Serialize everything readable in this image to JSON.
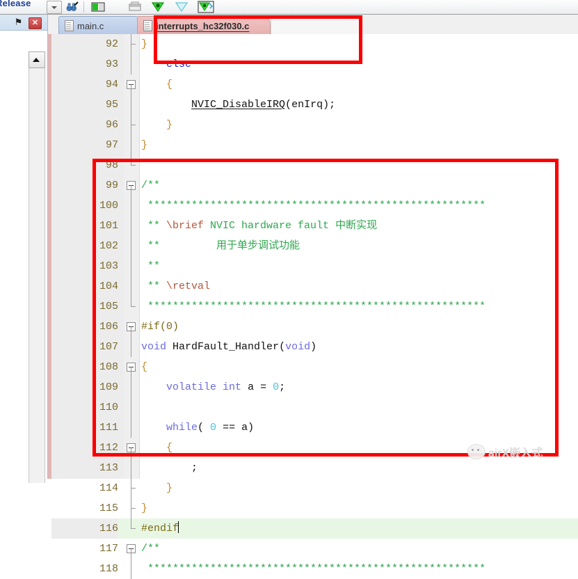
{
  "toolbar": {
    "target_label": "Release",
    "buttons": [
      {
        "name": "target-options-dropdown",
        "icon": "chevron-down-icon"
      },
      {
        "name": "binoculars-button",
        "icon": "binoculars-icon"
      },
      {
        "name": "manage-project-items-button",
        "icon": "project-items-icon"
      },
      {
        "name": "window-button",
        "icon": "window-icon"
      },
      {
        "name": "configure-target-button",
        "icon": "green-diamond-icon"
      },
      {
        "name": "filter-button",
        "icon": "funnel-icon"
      },
      {
        "name": "manage-components-button",
        "icon": "components-icon"
      }
    ]
  },
  "dock": {
    "pin_icon": "pin-icon",
    "pin_glyph": "⚑",
    "close_label": "✕"
  },
  "tabs": {
    "items": [
      {
        "label": "main.c",
        "active": false,
        "name": "tab-main-c"
      },
      {
        "label": "interrupts_hc32f030.c",
        "active": true,
        "name": "tab-interrupts-hc32f030-c"
      }
    ]
  },
  "annotations": {
    "tab_highlight_color": "#fb0000",
    "code_highlight_color": "#fb0000"
  },
  "watermark": {
    "text": "airX嵌入式",
    "logo": "wechat-logo-icon"
  },
  "editor": {
    "current_line": 116,
    "lines": [
      {
        "n": "92",
        "fold": "tick",
        "html": "<span class=\"brace\">}</span>"
      },
      {
        "n": "93",
        "fold": "line",
        "html": "    <span class=\"kw2\">else</span>"
      },
      {
        "n": "94",
        "fold": "box",
        "html": "    <span class=\"brace\">{</span>"
      },
      {
        "n": "95",
        "fold": "line",
        "html": "        <span class=\"id ul\">NVIC_DisableIRQ</span>(<span class=\"id\">enIrq</span>);"
      },
      {
        "n": "96",
        "fold": "tick",
        "html": "    <span class=\"brace\">}</span>"
      },
      {
        "n": "97",
        "fold": "line",
        "html": "<span class=\"brace\">}</span>"
      },
      {
        "n": "98",
        "fold": "end",
        "html": ""
      },
      {
        "n": "99",
        "fold": "box",
        "html": "<span class=\"cm\">/**</span>"
      },
      {
        "n": "100",
        "fold": "line",
        "html": "<span class=\"cmstar\"> ******************************************************</span>"
      },
      {
        "n": "101",
        "fold": "line",
        "html": "<span class=\"cmstar\"> ** </span><span class=\"doc\">\\brief</span><span class=\"cm\"> NVIC hardware fault </span><span class=\"cn\">中断实现</span>"
      },
      {
        "n": "102",
        "fold": "line",
        "html": "<span class=\"cmstar\"> ** </span><span class=\"cn\">        用于单步调试功能</span>"
      },
      {
        "n": "103",
        "fold": "line",
        "html": "<span class=\"cmstar\"> **</span>"
      },
      {
        "n": "104",
        "fold": "line",
        "html": "<span class=\"cmstar\"> ** </span><span class=\"doc\">\\retval</span>"
      },
      {
        "n": "105",
        "fold": "end",
        "html": "<span class=\"cmstar\"> ******************************************************</span>"
      },
      {
        "n": "106",
        "fold": "box",
        "html": "<span class=\"pp\">#if(0)</span>"
      },
      {
        "n": "107",
        "fold": "line",
        "html": "<span class=\"kw\">void</span> <span class=\"id\">HardFault_Handler</span>(<span class=\"kw\">void</span>)"
      },
      {
        "n": "108",
        "fold": "box",
        "html": "<span class=\"brace\">{</span>"
      },
      {
        "n": "109",
        "fold": "line",
        "html": "    <span class=\"kw\">volatile</span> <span class=\"kw\">int</span> a = <span class=\"num\">0</span>;"
      },
      {
        "n": "110",
        "fold": "line",
        "html": ""
      },
      {
        "n": "111",
        "fold": "line",
        "html": "    <span class=\"kw\">while</span>( <span class=\"num\">0</span> == a)"
      },
      {
        "n": "112",
        "fold": "box",
        "html": "    <span class=\"brace\">{</span>"
      },
      {
        "n": "113",
        "fold": "line",
        "html": "        ;"
      },
      {
        "n": "114",
        "fold": "tick",
        "html": "    <span class=\"brace\">}</span>"
      },
      {
        "n": "115",
        "fold": "tick",
        "html": "<span class=\"brace\">}</span>"
      },
      {
        "n": "116",
        "fold": "end",
        "html": "<span class=\"pp\">#endif</span><span class=\"caret\"></span>",
        "current": true
      },
      {
        "n": "117",
        "fold": "box",
        "html": "<span class=\"cm\">/**</span>"
      },
      {
        "n": "118",
        "fold": "line",
        "html": "<span class=\"cmstar\"> ******************************************************</span>"
      }
    ]
  }
}
